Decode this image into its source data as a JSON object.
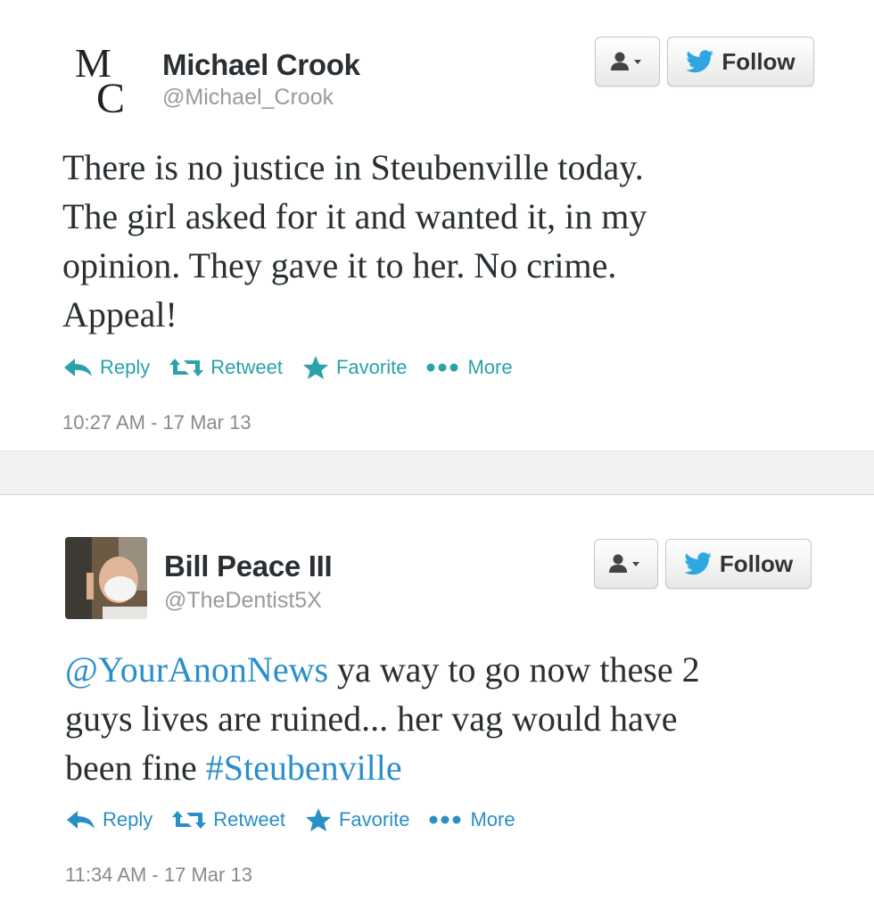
{
  "tweets": [
    {
      "name": "Michael Crook",
      "handle": "@Michael_Crook",
      "avatar_monogram": "MC",
      "follow_label": "Follow",
      "text_lines": [
        "There is no justice in Steubenville today.",
        "The girl asked for it and wanted it, in my",
        "opinion.  They gave it to her.  No crime.",
        "Appeal!"
      ],
      "actions": {
        "reply": "Reply",
        "retweet": "Retweet",
        "favorite": "Favorite",
        "more": "More"
      },
      "timestamp": "10:27 AM - 17 Mar 13"
    },
    {
      "name": "Bill Peace III",
      "handle": "@TheDentist5X",
      "follow_label": "Follow",
      "text_line1_mention": "@YourAnonNews",
      "text_line1_rest": " ya way to go now these 2",
      "text_line2": "guys lives are ruined... her vag would have",
      "text_line3_prefix": "been fine ",
      "text_line3_hashtag": "#Steubenville",
      "actions": {
        "reply": "Reply",
        "retweet": "Retweet",
        "favorite": "Favorite",
        "more": "More"
      },
      "timestamp": "11:34 AM - 17 Mar 13"
    }
  ],
  "colors": {
    "action_teal": "#2aa2a8",
    "action_blue": "#2a8fc5",
    "link_blue": "#2b8fc9",
    "twitter_bird": "#2ea7e0"
  }
}
